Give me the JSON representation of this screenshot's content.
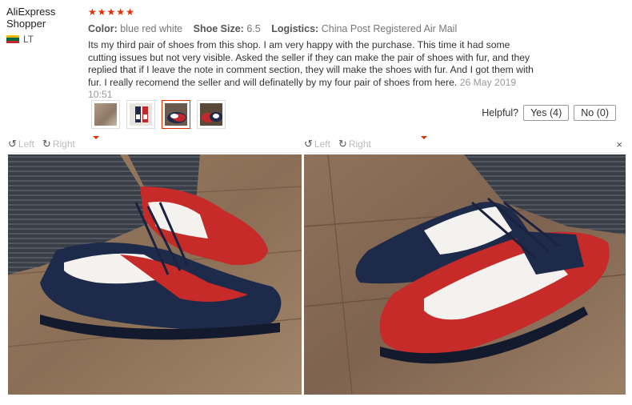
{
  "reviewer": {
    "name": "AliExpress Shopper",
    "country": "LT"
  },
  "review": {
    "stars": 5,
    "attributes": [
      {
        "key": "Color:",
        "value": "blue red white"
      },
      {
        "key": "Shoe Size:",
        "value": "6.5"
      },
      {
        "key": "Logistics:",
        "value": "China Post Registered Air Mail"
      }
    ],
    "text": "Its my third pair of shoes from this shop. I am very happy with the purchase. This time it had some cutting issues but not very visible. Asked the seller if they can make the pair of shoes with fur, and they replied that if I leave the note in comment section, they will make the shoes with fur. And I got them with fur. I really recomend the seller and will definatelly by my four pair of shoes from here.",
    "date": "26 May 2019 10:51"
  },
  "helpful": {
    "label": "Helpful?",
    "yes": "Yes (4)",
    "no": "No (0)"
  },
  "viewer": {
    "rotate_left": "Left",
    "rotate_right": "Right",
    "close": "×"
  },
  "colors": {
    "star": "#e62e04",
    "accent": "#e62e04"
  }
}
